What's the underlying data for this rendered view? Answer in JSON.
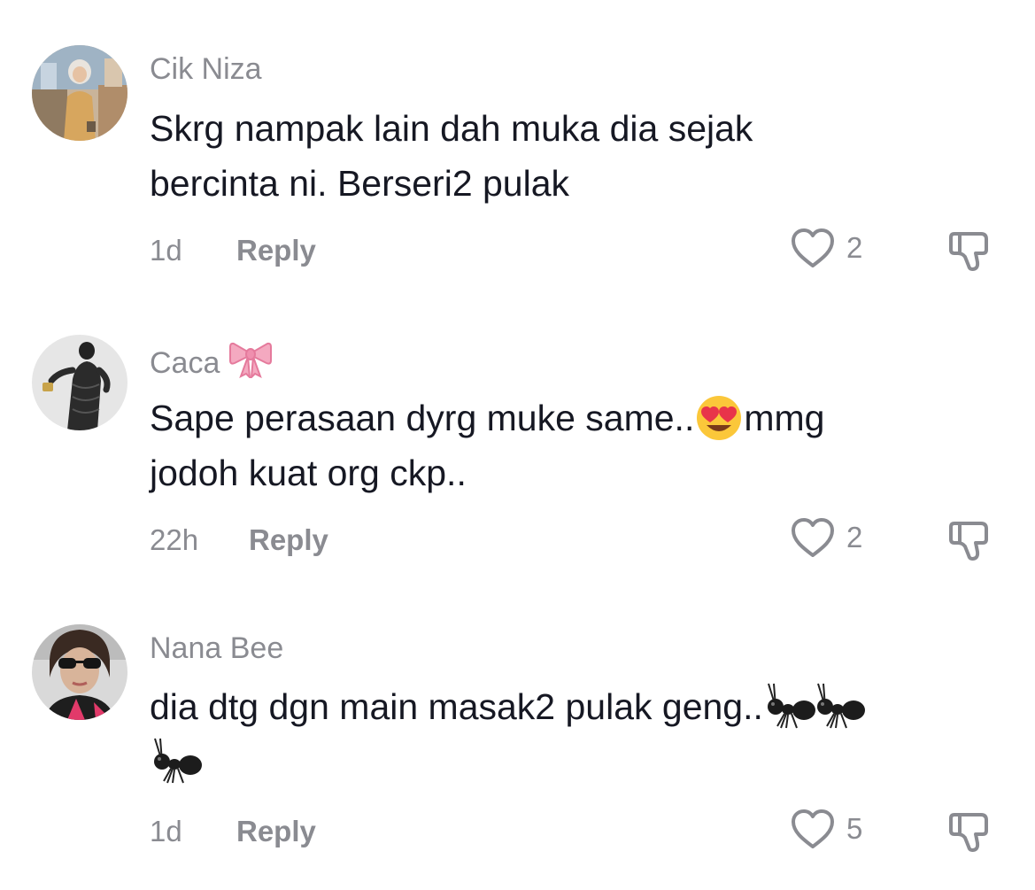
{
  "comments": [
    {
      "author": "Cik Niza",
      "text_line1": "Skrg nampak lain dah muka dia sejak",
      "text_line2": "bercinta ni. Berseri2 pulak",
      "time": "1d",
      "reply_label": "Reply",
      "likes": "2"
    },
    {
      "author": "Caca",
      "author_emoji": "ribbon-emoji",
      "text_part1": "Sape perasaan dyrg muke same..",
      "text_emoji": "heart-eyes-emoji",
      "text_part2": "mmg",
      "text_line2": "jodoh kuat org ckp..",
      "time": "22h",
      "reply_label": "Reply",
      "likes": "2"
    },
    {
      "author": "Nana Bee",
      "text_line1": "dia dtg dgn main masak2 pulak geng..",
      "text_emoji": "ant-emoji",
      "time": "1d",
      "reply_label": "Reply",
      "likes": "5"
    }
  ],
  "colors": {
    "text": "#161823",
    "secondary": "#8a8b91"
  }
}
